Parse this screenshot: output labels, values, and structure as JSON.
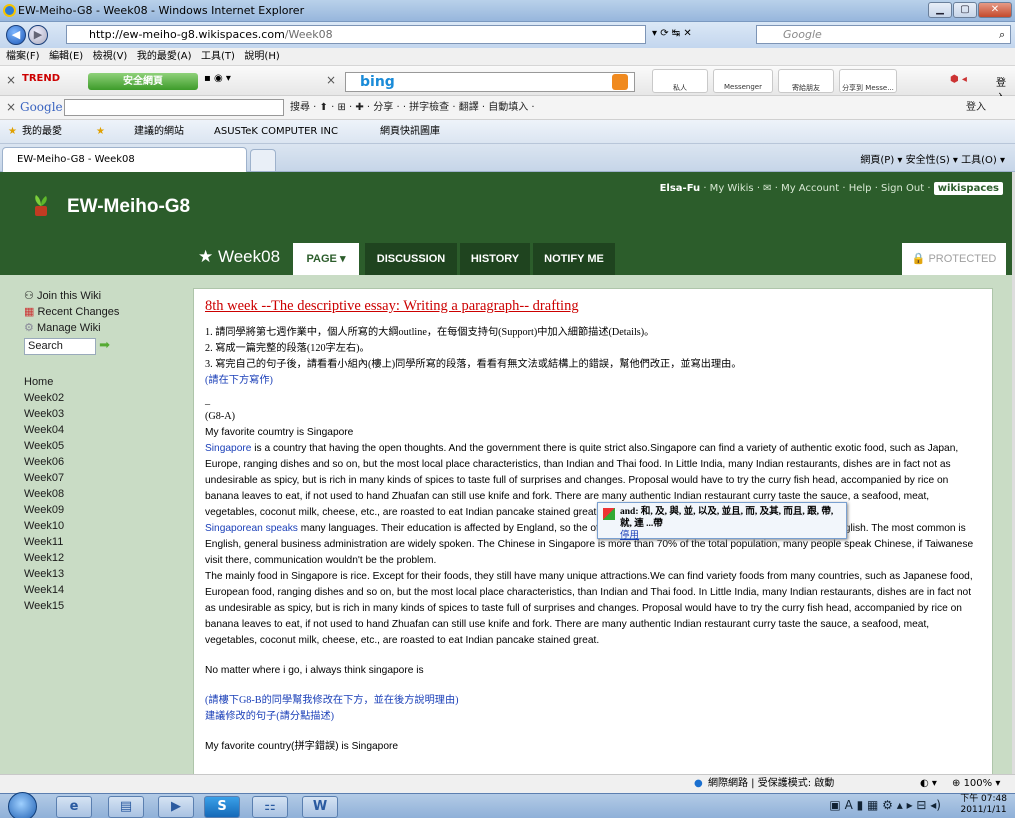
{
  "browser": {
    "window_title": "EW-Meiho-G8 - Week08 - Windows Internet Explorer",
    "url_host": "http://ew-meiho-g8.wikispaces.com",
    "url_path": "/Week08",
    "search_placeholder": "Google",
    "menu": [
      "檔案(F)",
      "編輯(E)",
      "檢視(V)",
      "我的最愛(A)",
      "工具(T)",
      "說明(H)"
    ],
    "trend_label": "TREND",
    "safe_label": "安全網頁",
    "bing_label": "bing",
    "tiles": [
      "私人",
      "Messenger",
      "寄給朋友",
      "分享到 Messe..."
    ],
    "login_label": "登入",
    "google_bar": {
      "label": "Google",
      "items": "搜尋 · ⬆ · ⊞ · ✚ ·  分享 ·  ·  拼字檢查 ·  翻譯 ·  自動填入 ·"
    },
    "favorites": {
      "fav": "我的最愛",
      "suggested": "建議的網站",
      "asus": "ASUSTeK COMPUTER INC",
      "webslice": "網頁快訊圖庫"
    },
    "tab_title": "EW-Meiho-G8 - Week08",
    "cmd_items": "網頁(P) ▾   安全性(S) ▾   工具(O) ▾",
    "status_text": "網際網路 | 受保護模式: 啟動",
    "zoom": "100%"
  },
  "wiki": {
    "site_name": "EW-Meiho-G8",
    "user": "Elsa-Fu",
    "user_links": "· My Wikis · ✉ · My Account · Help · Sign Out ·",
    "ws_label": "wikispaces",
    "page_title": "★ Week08",
    "tabs": [
      "PAGE",
      "DISCUSSION",
      "HISTORY",
      "NOTIFY ME"
    ],
    "protected": "PROTECTED",
    "sidebar": {
      "join": "Join this Wiki",
      "recent": "Recent Changes",
      "manage": "Manage Wiki",
      "search": "Search",
      "nav": [
        "Home",
        "Week02",
        "Week03",
        "Week04",
        "Week05",
        "Week06",
        "Week07",
        "Week08",
        "Week09",
        "Week10",
        "Week11",
        "Week12",
        "Week13",
        "Week14",
        "Week15"
      ]
    },
    "content": {
      "title": "8th week --The descriptive essay: Writing a paragraph-- drafting",
      "instr1": "1. 請同學將第七週作業中，個人所寫的大綱outline，在每個支持句(Support)中加入細節描述(Details)。",
      "instr2": "2. 寫成一篇完整的段落(120字左右)。",
      "instr3": "3. 寫完自己的句子後，請看看小組內(樓上)同學所寫的段落，看看有無文法或結構上的錯誤，幫他們改正，並寫出理由。",
      "write_below": "(請在下方寫作)",
      "dash": "_",
      "group": "(G8-A)",
      "fav_line": "My favorite coumtry is Singapore",
      "p1_link": "Singapore",
      "p1": " is a country that having the open thoughts. And the government there is quite strict also.Singapore can find a variety of authentic exotic food, such as Japan, Europe, ranging dishes and so on, but the most local place characteristics, than Indian and Thai food. In Little India, many Indian restaurants, dishes are in fact not as undesirable as spicy, but is rich in many kinds of spices to taste full of surprises and changes. Proposal would have to try the curry fish head, accompanied by rice on banana leaves to eat, if not used to hand Zhuafan can still use knife and fork. There are many authentic Indian restaurant curry taste the sauce, a seafood, meat, vegetables, coconut milk, cheese, etc., are roasted to eat Indian pancake stained great.",
      "p2_link": "Singaporean speaks",
      "p2": " many languages. Their education is affected by England, so the official languages of Singapore: Malay, Mandarin and English. The most common is English, general business administration are widely spoken. The Chinese in Singapore is more than 70% of the total population, many people speak Chinese, if Taiwanese visit there, communication wouldn't be the problem.",
      "p3": "The mainly food in Singapore is rice. Except for their foods, they still have many unique attractions.We can find variety foods from many countries, such as Japanese food, European food, ranging dishes and so on, but the most local place characteristics, than Indian and Thai food. In Little India, many Indian restaurants, dishes are in fact not as undesirable as spicy, but is rich in many kinds of spices to taste full of surprises and changes. Proposal would have to try the curry fish head, accompanied by rice on banana leaves to eat, if not used to hand Zhuafan can still use knife and fork. There are many authentic Indian restaurant curry taste the sauce, a seafood, meat, vegetables, coconut milk, cheese, etc., are roasted to eat Indian pancake stained great.",
      "closing": "No matter where i go, i always think singapore is",
      "edit1": "(請樓下G8-B的同學幫我修改在下方，並在後方說明理由)",
      "edit2": "建議修改的句子(請分點描述)",
      "bottom_line": "My favorite country(拼字錯誤) is Singapore"
    },
    "popup": {
      "text": "and: 和, 及, 與, 並, 以及, 並且, 而, 及其, 而且, 跟, 帶, 就, 連 ...帶",
      "stop": "停用"
    }
  },
  "taskbar": {
    "clock_time": "下午 07:48",
    "clock_date": "2011/1/11"
  }
}
